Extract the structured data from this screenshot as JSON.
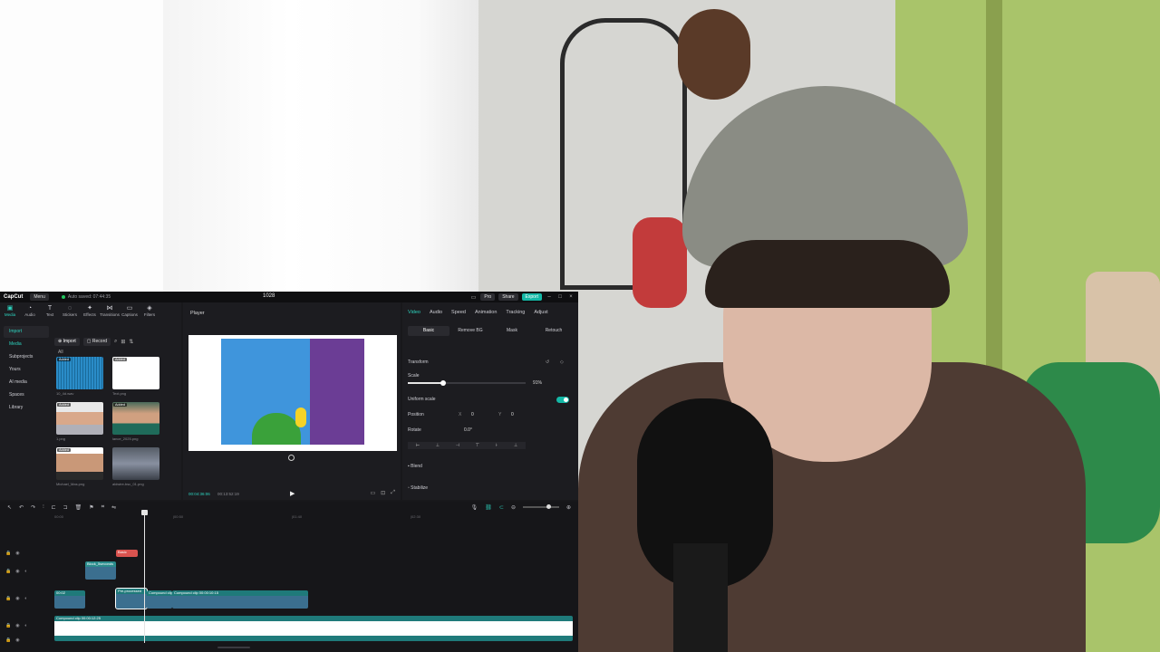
{
  "capcut": {
    "app_name": "CapCut",
    "menu_label": "Menu",
    "autosave": "Auto saved: 07:44:35",
    "project_name": "1028",
    "pro_label": "Pro",
    "share_label": "Share",
    "export_label": "Export"
  },
  "tools": [
    {
      "icon": "media-icon",
      "glyph": "▣",
      "label": "Media",
      "active": true
    },
    {
      "icon": "audio-icon",
      "glyph": "◔",
      "label": "Audio"
    },
    {
      "icon": "text-icon",
      "glyph": "T",
      "label": "Text"
    },
    {
      "icon": "stickers-icon",
      "glyph": "◌",
      "label": "Stickers"
    },
    {
      "icon": "effects-icon",
      "glyph": "✦",
      "label": "Effects"
    },
    {
      "icon": "transitions-icon",
      "glyph": "⋈",
      "label": "Transitions"
    },
    {
      "icon": "captions-icon",
      "glyph": "▭",
      "label": "Captions"
    },
    {
      "icon": "filters-icon",
      "glyph": "◈",
      "label": "Filters"
    }
  ],
  "side_nav": [
    {
      "label": "Import",
      "state": "active"
    },
    {
      "label": "Media",
      "state": "selected"
    },
    {
      "label": "Subprojects",
      "state": ""
    },
    {
      "label": "Yours",
      "state": ""
    },
    {
      "label": "AI media",
      "state": ""
    },
    {
      "label": "Spaces",
      "state": ""
    },
    {
      "label": "Library",
      "state": ""
    }
  ],
  "media_toolbar": {
    "import_label": "Import",
    "record_label": "Record",
    "filter_all": "All"
  },
  "media_items": [
    {
      "caption": "10_4d.wav",
      "added": "Added",
      "kind": "audio"
    },
    {
      "caption": "Text.png",
      "added": "Added",
      "kind": "white"
    },
    {
      "caption": "1.png",
      "added": "Added",
      "kind": "person"
    },
    {
      "caption": "lance_2025.png",
      "added": "Added",
      "kind": "person2"
    },
    {
      "caption": "Michael_Mas.png",
      "added": "Added",
      "kind": "person3"
    },
    {
      "caption": "aldwire-bsc_01.png",
      "added": "",
      "kind": "race"
    }
  ],
  "player": {
    "title": "Player",
    "current_time": "00:04:36:06",
    "total_time": "00:13:52:19"
  },
  "props": {
    "tabs": [
      {
        "label": "Video",
        "active": true
      },
      {
        "label": "Audio"
      },
      {
        "label": "Speed"
      },
      {
        "label": "Animation"
      },
      {
        "label": "Tracking"
      },
      {
        "label": "Adjust"
      }
    ],
    "subtabs": [
      {
        "label": "Basic",
        "active": true
      },
      {
        "label": "Remove BG"
      },
      {
        "label": "Mask"
      },
      {
        "label": "Retouch"
      }
    ],
    "transform_label": "Transform",
    "scale_label": "Scale",
    "scale_value": "91%",
    "scale_fraction": 0.3,
    "uniform_label": "Uniform scale",
    "position_label": "Position",
    "pos_x_label": "X",
    "pos_x": "0",
    "pos_y_label": "Y",
    "pos_y": "0",
    "rotate_label": "Rotate",
    "rotate_value": "0.0°",
    "blend_label": "Blend",
    "stabilize_label": "Stabilize"
  },
  "timeline": {
    "ruler": [
      "00:00",
      "|00:50",
      "|01:40",
      "|02:30"
    ],
    "clips": [
      {
        "label": "Basic",
        "color": "#d9534f",
        "track": "text"
      },
      {
        "label": "Block_5seconds",
        "color": "#2a8c8c",
        "track": "overlay"
      },
      {
        "label": "00:02",
        "color": "#1f7a7a",
        "track": "main"
      },
      {
        "label": "Pre-processed",
        "color": "#1f7a7a",
        "track": "main"
      },
      {
        "label": "Compound clip",
        "color": "#1f7a7a",
        "track": "main"
      },
      {
        "label": "Compound clip 00:00:10:15",
        "color": "#1f7a7a",
        "track": "main"
      },
      {
        "label": "Compound clip 00:00:12:25",
        "color": "#1f7a7a",
        "track": "bottom"
      }
    ]
  }
}
